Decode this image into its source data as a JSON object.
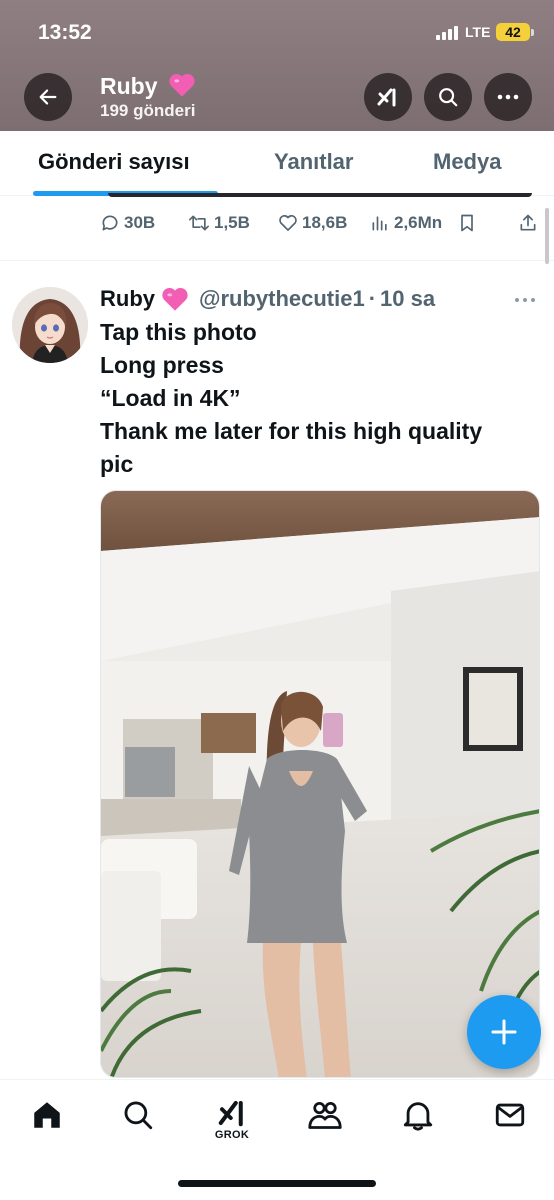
{
  "status_bar": {
    "time": "13:52",
    "network": "LTE",
    "battery": "42"
  },
  "header": {
    "name": "Ruby",
    "post_count": "199 gönderi",
    "icons": [
      "back-arrow-icon",
      "grok-icon",
      "search-icon",
      "more-icon"
    ]
  },
  "tabs": [
    {
      "label": "Gönderi sayısı",
      "active": true
    },
    {
      "label": "Yanıtlar",
      "active": false
    },
    {
      "label": "Medya",
      "active": false
    }
  ],
  "previous_tweet": {
    "replies": "30B",
    "retweets": "1,5B",
    "likes": "18,6B",
    "views": "2,6Mn"
  },
  "tweet": {
    "name": "Ruby",
    "handle": "@rubythecutie1",
    "separator": "·",
    "time": "10 sa",
    "lines": [
      "Tap this photo",
      "Long press",
      "“Load in 4K”",
      "Thank me later for this high quality",
      "pic"
    ]
  },
  "bottom_nav": {
    "grok_label": "GROK",
    "icons": [
      "home-icon",
      "search-icon",
      "grok-icon",
      "communities-icon",
      "notifications-icon",
      "messages-icon"
    ]
  },
  "colors": {
    "accent": "#1d9bf0",
    "header_bg": "#857578",
    "text_primary": "#0f1419",
    "text_secondary": "#536471",
    "heart": "#f25eb4"
  }
}
